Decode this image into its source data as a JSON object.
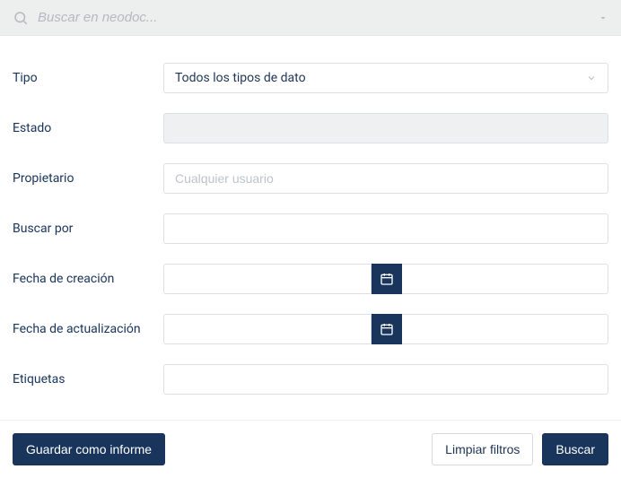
{
  "search": {
    "placeholder": "Buscar en neodoc..."
  },
  "form": {
    "tipo": {
      "label": "Tipo",
      "selected": "Todos los tipos de dato"
    },
    "estado": {
      "label": "Estado",
      "value": ""
    },
    "propietario": {
      "label": "Propietario",
      "placeholder": "Cualquier usuario",
      "value": ""
    },
    "buscar_por": {
      "label": "Buscar por",
      "value": ""
    },
    "fecha_creacion": {
      "label": "Fecha de creación",
      "from": "",
      "to": ""
    },
    "fecha_actualizacion": {
      "label": "Fecha de actualización",
      "from": "",
      "to": ""
    },
    "etiquetas": {
      "label": "Etiquetas",
      "value": ""
    }
  },
  "actions": {
    "guardar_informe": "Guardar como informe",
    "limpiar": "Limpiar filtros",
    "buscar": "Buscar"
  },
  "icons": {
    "search": "search-icon",
    "dropdown": "chevron-down-icon",
    "calendar": "calendar-icon"
  },
  "colors": {
    "primary": "#19355b"
  }
}
